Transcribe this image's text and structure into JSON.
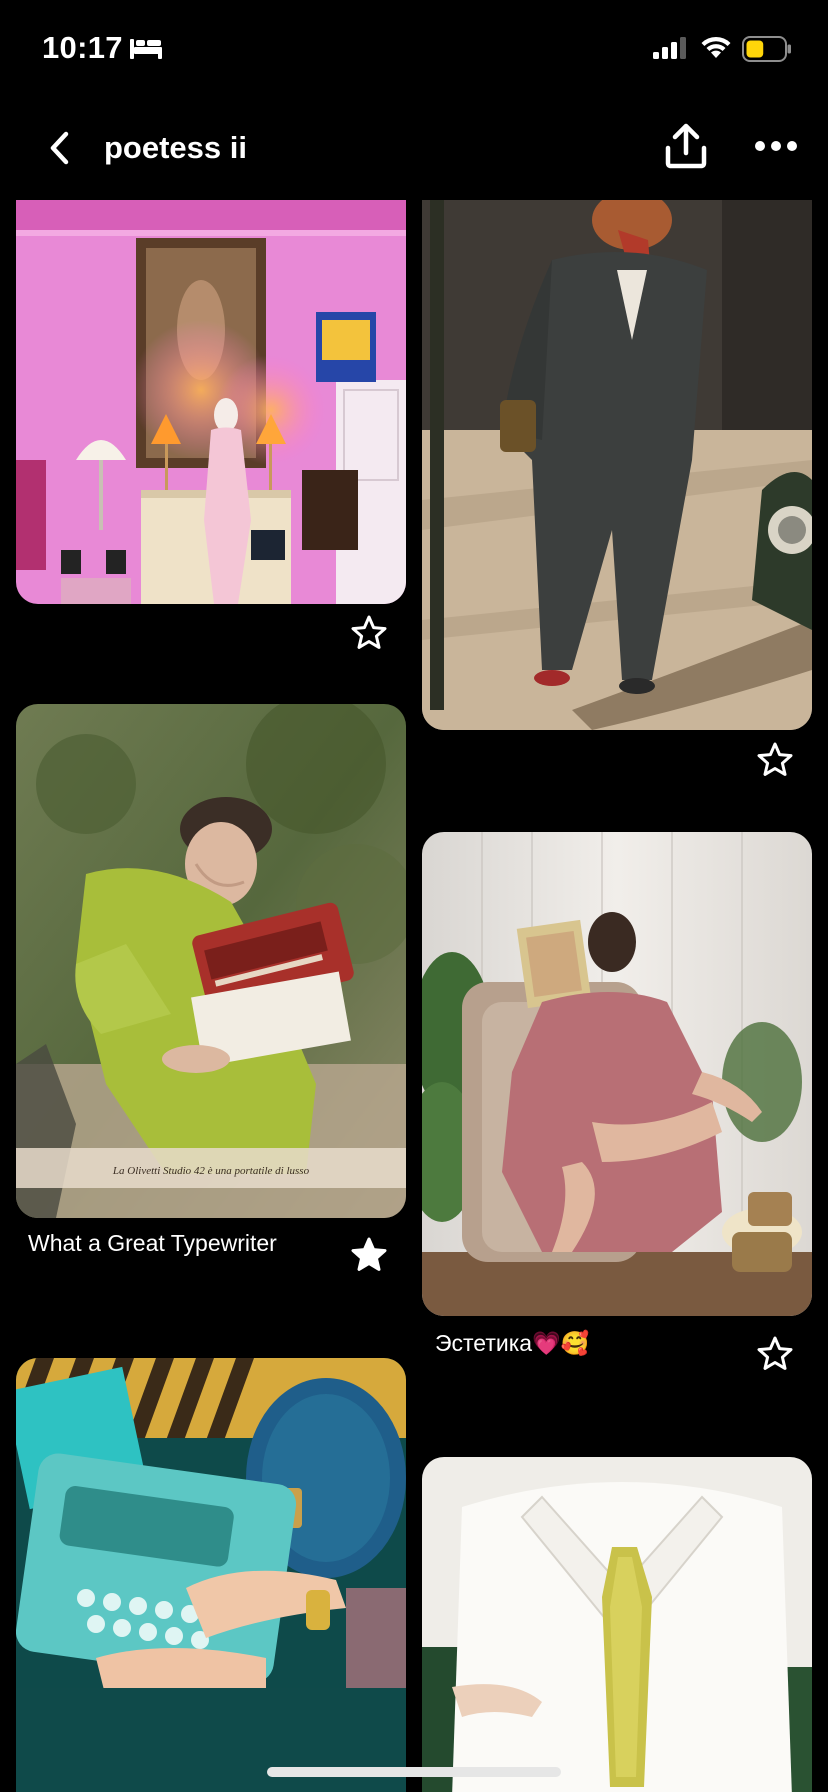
{
  "status_bar": {
    "time": "10:17",
    "sleep_icon": "bed-icon",
    "signal_icon": "cellular-signal-icon",
    "wifi_icon": "wifi-icon",
    "battery_icon": "battery-icon",
    "battery_color": "#ffd60a",
    "battery_level": 0.3
  },
  "header": {
    "title": "poetess ii",
    "back_icon": "chevron-left-icon",
    "share_icon": "share-icon",
    "more_icon": "more-horizontal-icon"
  },
  "pins": [
    {
      "id": "pink-room",
      "caption": "",
      "saved": false
    },
    {
      "id": "suit-walk",
      "caption": "",
      "saved": false
    },
    {
      "id": "typewriter-ad",
      "caption": "What a Great Typewriter",
      "saved": true
    },
    {
      "id": "pink-dress-reading",
      "caption": "Эстетика💗🥰",
      "saved": false
    },
    {
      "id": "teal-typewriter",
      "caption": "",
      "saved": false
    },
    {
      "id": "lace-tie",
      "caption": "",
      "saved": false
    }
  ],
  "pin_image_text": {
    "typewriter_ad_banner": "La Olivetti Studio 42 è una portatile di lusso"
  }
}
